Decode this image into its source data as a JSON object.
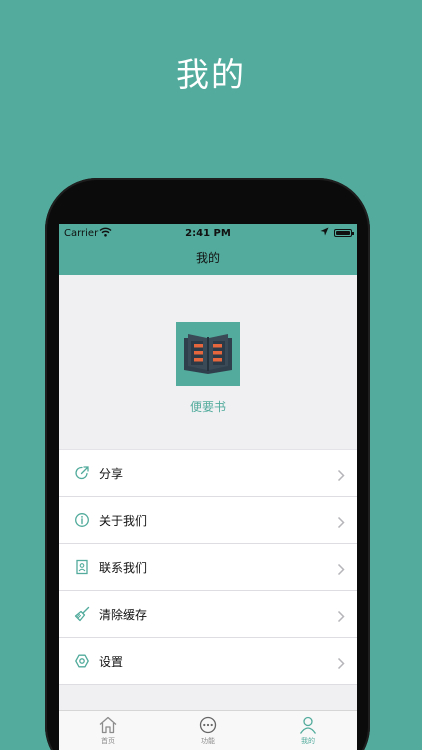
{
  "promo": {
    "title": "我的"
  },
  "status_bar": {
    "carrier": "Carrier",
    "time": "2:41 PM"
  },
  "nav": {
    "title": "我的"
  },
  "app": {
    "name": "便要书",
    "logo_icon": "open-book-icon"
  },
  "menu": {
    "items": [
      {
        "label": "分享",
        "icon": "share-icon"
      },
      {
        "label": "关于我们",
        "icon": "info-icon"
      },
      {
        "label": "联系我们",
        "icon": "contact-icon"
      },
      {
        "label": "清除缓存",
        "icon": "broom-icon"
      },
      {
        "label": "设置",
        "icon": "settings-icon"
      }
    ]
  },
  "tabs": [
    {
      "label": "首页",
      "icon": "home-icon",
      "active": false
    },
    {
      "label": "功能",
      "icon": "more-icon",
      "active": false
    },
    {
      "label": "我的",
      "icon": "person-icon",
      "active": true
    }
  ],
  "colors": {
    "accent": "#52ab9c",
    "background": "#f0f0f3"
  }
}
